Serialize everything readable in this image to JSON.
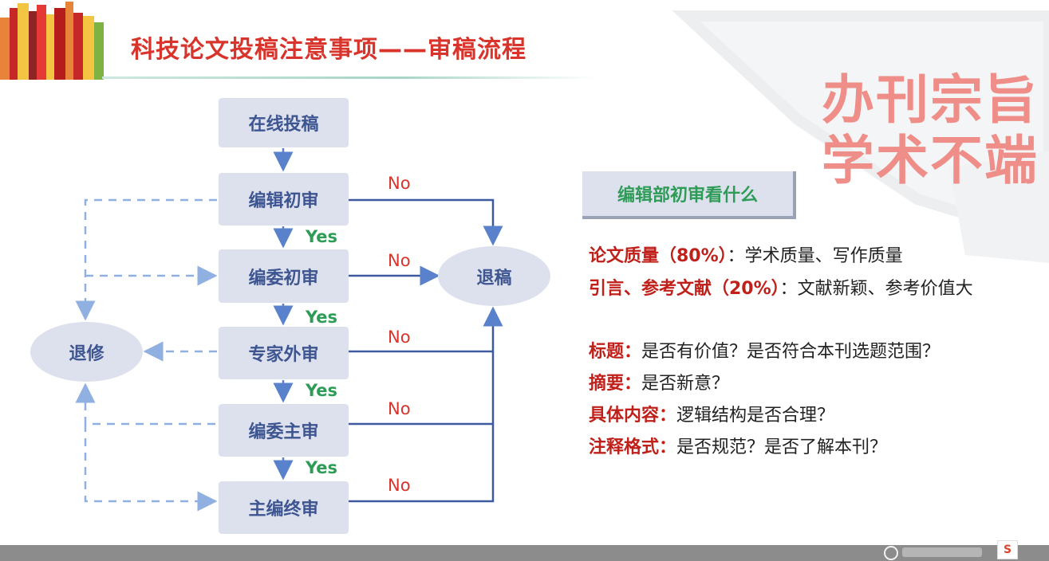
{
  "header": {
    "title": "科技论文投稿注意事项——审稿流程"
  },
  "stamp": {
    "line1": "办刊宗旨",
    "line2": "学术不端"
  },
  "flow": {
    "steps": [
      "在线投稿",
      "编辑初审",
      "编委初审",
      "专家外审",
      "编委主审",
      "主编终审"
    ],
    "reject_label": "退稿",
    "revise_label": "退修",
    "no_label": "No",
    "yes_label": "Yes"
  },
  "callout": {
    "title": "编辑部初审看什么"
  },
  "criteria": [
    {
      "key": "论文质量（80%）",
      "text": "：学术质量、写作质量"
    },
    {
      "key": "引言、参考文献（20%）",
      "text": "：文献新颖、参考价值大"
    },
    {
      "key": "标题：",
      "text": "是否有价值？是否符合本刊选题范围？"
    },
    {
      "key": "摘要：",
      "text": "是否新意？"
    },
    {
      "key": "具体内容：",
      "text": "逻辑结构是否合理？"
    },
    {
      "key": "注释格式：",
      "text": "是否规范？是否了解本刊？"
    }
  ],
  "colors": {
    "title_red": "#d9342b",
    "box_fill": "#dde1ee",
    "box_text": "#3d5591",
    "solid_arrow": "#3d5aa0",
    "dashed_arrow": "#8fb0e0",
    "yes_green": "#2e9c57"
  }
}
